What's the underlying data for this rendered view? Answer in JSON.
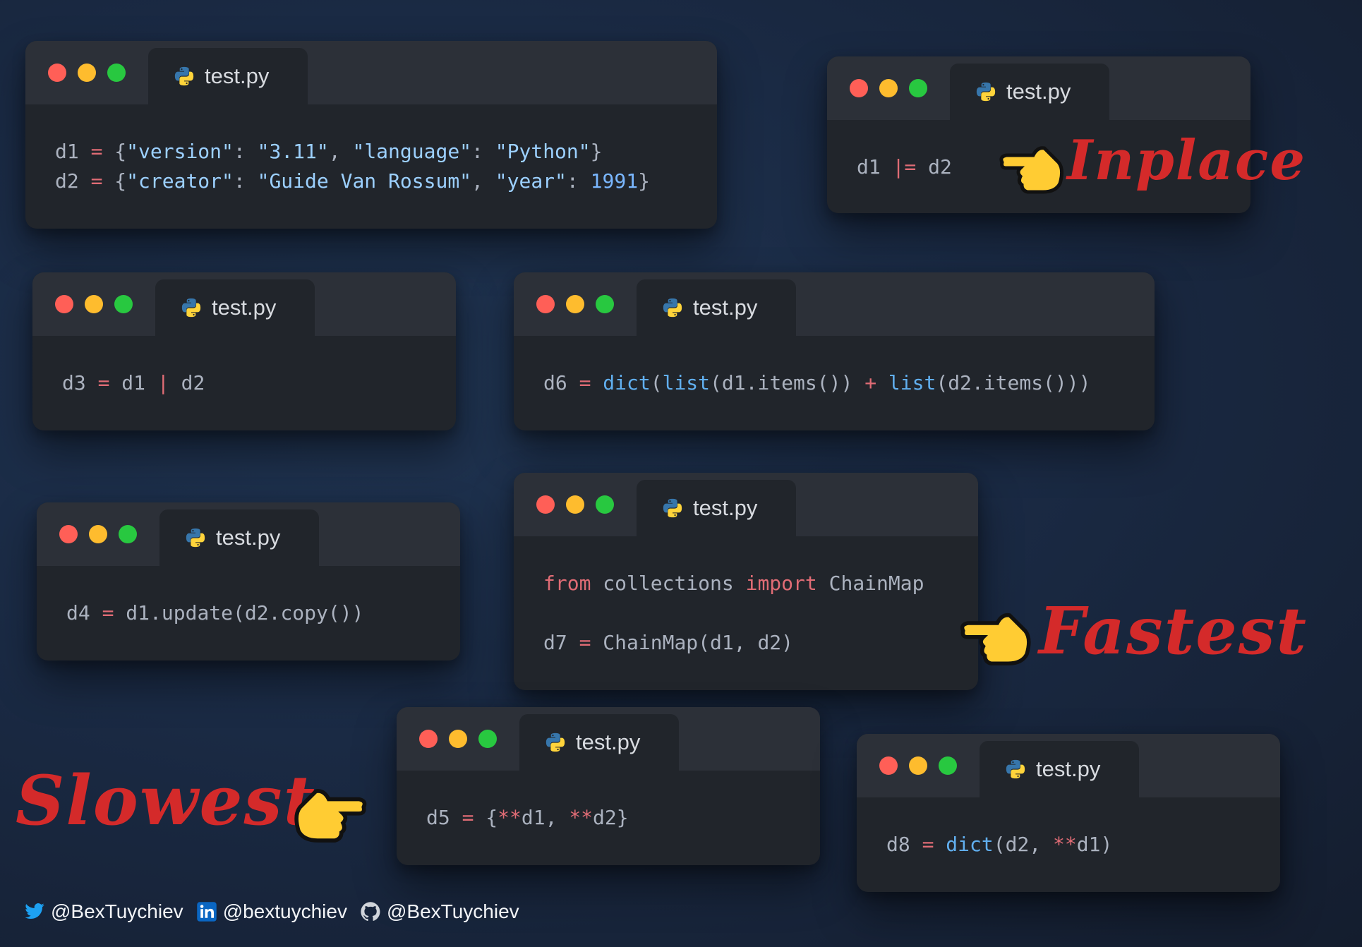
{
  "windows": [
    {
      "id": "w1",
      "tab": "test.py",
      "lines": [
        [
          [
            "d1 ",
            ""
          ],
          [
            "=",
            "kw"
          ],
          [
            " {",
            ""
          ],
          [
            "\"version\"",
            "str"
          ],
          [
            ": ",
            ""
          ],
          [
            "\"3.11\"",
            "str"
          ],
          [
            ", ",
            ""
          ],
          [
            "\"language\"",
            "str"
          ],
          [
            ": ",
            ""
          ],
          [
            "\"Python\"",
            "str"
          ],
          [
            "}",
            ""
          ]
        ],
        [
          [
            "d2 ",
            ""
          ],
          [
            "=",
            "kw"
          ],
          [
            " {",
            ""
          ],
          [
            "\"creator\"",
            "str"
          ],
          [
            ": ",
            ""
          ],
          [
            "\"Guide Van Rossum\"",
            "str"
          ],
          [
            ", ",
            ""
          ],
          [
            "\"year\"",
            "str"
          ],
          [
            ": ",
            ""
          ],
          [
            "1991",
            "num"
          ],
          [
            "}",
            ""
          ]
        ]
      ]
    },
    {
      "id": "w2",
      "tab": "test.py",
      "lines": [
        [
          [
            "d1 ",
            ""
          ],
          [
            "|=",
            "kw"
          ],
          [
            " d2",
            ""
          ]
        ]
      ]
    },
    {
      "id": "w3",
      "tab": "test.py",
      "lines": [
        [
          [
            "d3 ",
            ""
          ],
          [
            "=",
            "kw"
          ],
          [
            " d1 ",
            ""
          ],
          [
            "|",
            "kw"
          ],
          [
            " d2",
            ""
          ]
        ]
      ]
    },
    {
      "id": "w4",
      "tab": "test.py",
      "lines": [
        [
          [
            "d6 ",
            ""
          ],
          [
            "=",
            "kw"
          ],
          [
            " ",
            ""
          ],
          [
            "dict",
            "fn"
          ],
          [
            "(",
            ""
          ],
          [
            "list",
            "fn"
          ],
          [
            "(d1.items()) ",
            ""
          ],
          [
            "+",
            "kw"
          ],
          [
            " ",
            ""
          ],
          [
            "list",
            "fn"
          ],
          [
            "(d2.items()))",
            ""
          ]
        ]
      ]
    },
    {
      "id": "w5",
      "tab": "test.py",
      "lines": [
        [
          [
            "d4 ",
            ""
          ],
          [
            "=",
            "kw"
          ],
          [
            " d1.update(d2.copy())",
            ""
          ]
        ]
      ]
    },
    {
      "id": "w6",
      "tab": "test.py",
      "lines": [
        [
          [
            "from",
            "kw"
          ],
          [
            " collections ",
            ""
          ],
          [
            "import",
            "kw"
          ],
          [
            " ChainMap",
            ""
          ]
        ],
        [
          [
            "",
            ""
          ]
        ],
        [
          [
            "d7 ",
            ""
          ],
          [
            "=",
            "kw"
          ],
          [
            " ChainMap(d1, d2)",
            ""
          ]
        ]
      ]
    },
    {
      "id": "w7",
      "tab": "test.py",
      "lines": [
        [
          [
            "d5 ",
            ""
          ],
          [
            "=",
            "kw"
          ],
          [
            " {",
            ""
          ],
          [
            "**",
            "kw"
          ],
          [
            "d1, ",
            ""
          ],
          [
            "**",
            "kw"
          ],
          [
            "d2}",
            ""
          ]
        ]
      ]
    },
    {
      "id": "w8",
      "tab": "test.py",
      "lines": [
        [
          [
            "d8 ",
            ""
          ],
          [
            "=",
            "kw"
          ],
          [
            " ",
            ""
          ],
          [
            "dict",
            "fn"
          ],
          [
            "(d2, ",
            ""
          ],
          [
            "**",
            "kw"
          ],
          [
            "d1)",
            ""
          ]
        ]
      ]
    }
  ],
  "annotations": {
    "inplace": "Inplace",
    "fastest": "Fastest",
    "slowest": "Slowest"
  },
  "footer": {
    "twitter": "@BexTuychiev",
    "linkedin": "@bextuychiev",
    "github": "@BexTuychiev"
  },
  "icons": {
    "window_dots": [
      "red",
      "yellow",
      "green"
    ],
    "tab_icon": "python-logo-icon",
    "hand": "pointing-hand-icon"
  },
  "colors": {
    "annotation": "#d42a2a",
    "keyword": "#e06c75",
    "function": "#61afef",
    "string": "#9cd0ff"
  }
}
